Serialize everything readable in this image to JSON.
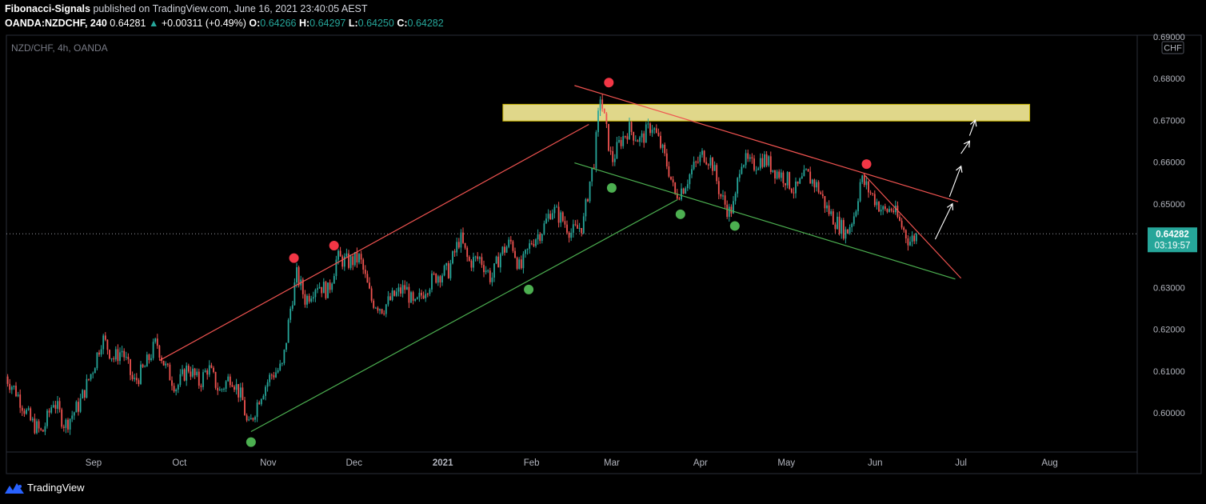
{
  "header": {
    "author": "Fibonacci-Signals",
    "published_text": " published on TradingView.com, June 16, 2021 23:40:05 AEST",
    "symbol": "OANDA:NZDCHF, 240",
    "last": "0.64281",
    "change_arrow": "▲",
    "change": "+0.00311 (+0.49%)",
    "o_label": "O:",
    "o_value": "0.64266",
    "h_label": "H:",
    "h_value": "0.64297",
    "l_label": "L:",
    "l_value": "0.64250",
    "c_label": "C:",
    "c_value": "0.64282"
  },
  "footer": {
    "brand": "TradingView",
    "logo_icon": "tradingview-logo-icon"
  },
  "colors": {
    "background": "#000000",
    "up_candle": "#26a69a",
    "down_candle": "#ef5350",
    "resistance_line": "#ef5350",
    "support_line": "#4caf50",
    "zone_fill": "#fff59d",
    "price_label_bg": "#26a69a",
    "axis_text": "#b2b5be"
  },
  "chart_data": {
    "type": "candlestick",
    "title": "NZD/CHF, 4h, OANDA",
    "currency_badge": "CHF",
    "xlabel": "",
    "ylabel": "",
    "ylim": [
      0.592,
      0.6845
    ],
    "x_range": [
      "2021-08-01",
      "2021-08-31"
    ],
    "grid": false,
    "x_ticks": [
      {
        "label": "Sep",
        "date": "2020-09-01"
      },
      {
        "label": "Oct",
        "date": "2020-10-01"
      },
      {
        "label": "Nov",
        "date": "2020-11-01"
      },
      {
        "label": "Dec",
        "date": "2020-12-01"
      },
      {
        "label": "2021",
        "date": "2021-01-01",
        "bold": true
      },
      {
        "label": "Feb",
        "date": "2021-02-01"
      },
      {
        "label": "Mar",
        "date": "2021-03-01"
      },
      {
        "label": "Apr",
        "date": "2021-04-01"
      },
      {
        "label": "May",
        "date": "2021-05-01"
      },
      {
        "label": "Jun",
        "date": "2021-06-01"
      },
      {
        "label": "Jul",
        "date": "2021-07-01"
      },
      {
        "label": "Aug",
        "date": "2021-08-01"
      }
    ],
    "y_ticks": [
      "0.60000",
      "0.61000",
      "0.62000",
      "0.63000",
      "0.64000",
      "0.65000",
      "0.66000",
      "0.67000",
      "0.68000",
      "0.69000"
    ],
    "last_price": {
      "value": 0.64282,
      "label": "0.64282",
      "countdown": "03:19:57"
    },
    "price_path": [
      [
        "2020-08-01",
        0.609
      ],
      [
        "2020-08-05",
        0.605
      ],
      [
        "2020-08-10",
        0.598
      ],
      [
        "2020-08-14",
        0.595
      ],
      [
        "2020-08-18",
        0.603
      ],
      [
        "2020-08-22",
        0.597
      ],
      [
        "2020-08-27",
        0.602
      ],
      [
        "2020-09-01",
        0.611
      ],
      [
        "2020-09-04",
        0.618
      ],
      [
        "2020-09-08",
        0.613
      ],
      [
        "2020-09-11",
        0.615
      ],
      [
        "2020-09-15",
        0.607
      ],
      [
        "2020-09-19",
        0.611
      ],
      [
        "2020-09-23",
        0.617
      ],
      [
        "2020-09-26",
        0.611
      ],
      [
        "2020-09-30",
        0.606
      ],
      [
        "2020-10-04",
        0.611
      ],
      [
        "2020-10-08",
        0.607
      ],
      [
        "2020-10-11",
        0.611
      ],
      [
        "2020-10-15",
        0.605
      ],
      [
        "2020-10-19",
        0.609
      ],
      [
        "2020-10-23",
        0.603
      ],
      [
        "2020-10-25",
        0.596
      ],
      [
        "2020-10-29",
        0.604
      ],
      [
        "2020-11-02",
        0.609
      ],
      [
        "2020-11-06",
        0.611
      ],
      [
        "2020-11-09",
        0.626
      ],
      [
        "2020-11-11",
        0.633
      ],
      [
        "2020-11-14",
        0.627
      ],
      [
        "2020-11-18",
        0.631
      ],
      [
        "2020-11-22",
        0.629
      ],
      [
        "2020-11-25",
        0.637
      ],
      [
        "2020-11-29",
        0.636
      ],
      [
        "2020-12-03",
        0.637
      ],
      [
        "2020-12-07",
        0.627
      ],
      [
        "2020-12-11",
        0.625
      ],
      [
        "2020-12-15",
        0.628
      ],
      [
        "2020-12-19",
        0.63
      ],
      [
        "2020-12-22",
        0.625
      ],
      [
        "2020-12-26",
        0.63
      ],
      [
        "2020-12-30",
        0.633
      ],
      [
        "2021-01-03",
        0.634
      ],
      [
        "2021-01-07",
        0.642
      ],
      [
        "2021-01-10",
        0.636
      ],
      [
        "2021-01-14",
        0.637
      ],
      [
        "2021-01-18",
        0.632
      ],
      [
        "2021-01-21",
        0.638
      ],
      [
        "2021-01-25",
        0.641
      ],
      [
        "2021-01-28",
        0.634
      ],
      [
        "2021-02-01",
        0.641
      ],
      [
        "2021-02-05",
        0.644
      ],
      [
        "2021-02-08",
        0.649
      ],
      [
        "2021-02-12",
        0.646
      ],
      [
        "2021-02-15",
        0.643
      ],
      [
        "2021-02-19",
        0.645
      ],
      [
        "2021-02-21",
        0.654
      ],
      [
        "2021-02-23",
        0.661
      ],
      [
        "2021-02-25",
        0.676
      ],
      [
        "2021-02-27",
        0.668
      ],
      [
        "2021-03-01",
        0.66
      ],
      [
        "2021-03-04",
        0.665
      ],
      [
        "2021-03-07",
        0.668
      ],
      [
        "2021-03-11",
        0.665
      ],
      [
        "2021-03-15",
        0.669
      ],
      [
        "2021-03-18",
        0.664
      ],
      [
        "2021-03-21",
        0.658
      ],
      [
        "2021-03-23",
        0.652
      ],
      [
        "2021-03-26",
        0.654
      ],
      [
        "2021-03-29",
        0.658
      ],
      [
        "2021-04-02",
        0.662
      ],
      [
        "2021-04-05",
        0.66
      ],
      [
        "2021-04-08",
        0.652
      ],
      [
        "2021-04-11",
        0.648
      ],
      [
        "2021-04-13",
        0.65
      ],
      [
        "2021-04-15",
        0.661
      ],
      [
        "2021-04-19",
        0.659
      ],
      [
        "2021-04-23",
        0.661
      ],
      [
        "2021-04-27",
        0.658
      ],
      [
        "2021-05-01",
        0.656
      ],
      [
        "2021-05-04",
        0.653
      ],
      [
        "2021-05-08",
        0.657
      ],
      [
        "2021-05-12",
        0.654
      ],
      [
        "2021-05-15",
        0.649
      ],
      [
        "2021-05-18",
        0.646
      ],
      [
        "2021-05-22",
        0.643
      ],
      [
        "2021-05-25",
        0.648
      ],
      [
        "2021-05-27",
        0.656
      ],
      [
        "2021-05-29",
        0.654
      ],
      [
        "2021-06-01",
        0.651
      ],
      [
        "2021-06-04",
        0.648
      ],
      [
        "2021-06-07",
        0.649
      ],
      [
        "2021-06-10",
        0.645
      ],
      [
        "2021-06-13",
        0.641
      ],
      [
        "2021-06-16",
        0.6428
      ]
    ],
    "zone": {
      "from": "2021-01-22",
      "to": "2021-07-25",
      "low": 0.6698,
      "high": 0.6738
    },
    "trendlines": [
      {
        "role": "resistance",
        "color": "red",
        "from": [
          "2020-09-24",
          0.6125
        ],
        "to": [
          "2021-02-21",
          0.669
        ]
      },
      {
        "role": "support",
        "color": "green",
        "from": [
          "2020-10-26",
          0.5955
        ],
        "to": [
          "2021-03-24",
          0.651
        ]
      },
      {
        "role": "resistance",
        "color": "red",
        "from": [
          "2021-02-16",
          0.6783
        ],
        "to": [
          "2021-06-30",
          0.6505
        ]
      },
      {
        "role": "support",
        "color": "green",
        "from": [
          "2021-02-16",
          0.6598
        ],
        "to": [
          "2021-06-29",
          0.632
        ]
      },
      {
        "role": "resistance",
        "color": "red",
        "from": [
          "2021-05-28",
          0.6571
        ],
        "to": [
          "2021-07-01",
          0.6322
        ]
      }
    ],
    "swing_markers": [
      {
        "kind": "high",
        "date": "2020-11-10",
        "price": 0.637
      },
      {
        "kind": "high",
        "date": "2020-11-24",
        "price": 0.64
      },
      {
        "kind": "high",
        "date": "2021-02-28",
        "price": 0.679
      },
      {
        "kind": "high",
        "date": "2021-05-29",
        "price": 0.6595
      },
      {
        "kind": "low",
        "date": "2020-10-26",
        "price": 0.593
      },
      {
        "kind": "low",
        "date": "2021-01-31",
        "price": 0.6295
      },
      {
        "kind": "low",
        "date": "2021-03-01",
        "price": 0.6538
      },
      {
        "kind": "low",
        "date": "2021-03-25",
        "price": 0.6475
      },
      {
        "kind": "low",
        "date": "2021-04-13",
        "price": 0.6447
      }
    ],
    "projection_arrows": [
      {
        "from": [
          "2021-06-22",
          0.6415
        ],
        "to": [
          "2021-06-28",
          0.65
        ]
      },
      {
        "from": [
          "2021-06-27",
          0.6517
        ],
        "to": [
          "2021-07-01",
          0.659
        ]
      },
      {
        "from": [
          "2021-07-01",
          0.662
        ],
        "to": [
          "2021-07-04",
          0.665
        ]
      },
      {
        "from": [
          "2021-07-04",
          0.6663
        ],
        "to": [
          "2021-07-06",
          0.67
        ]
      }
    ]
  }
}
